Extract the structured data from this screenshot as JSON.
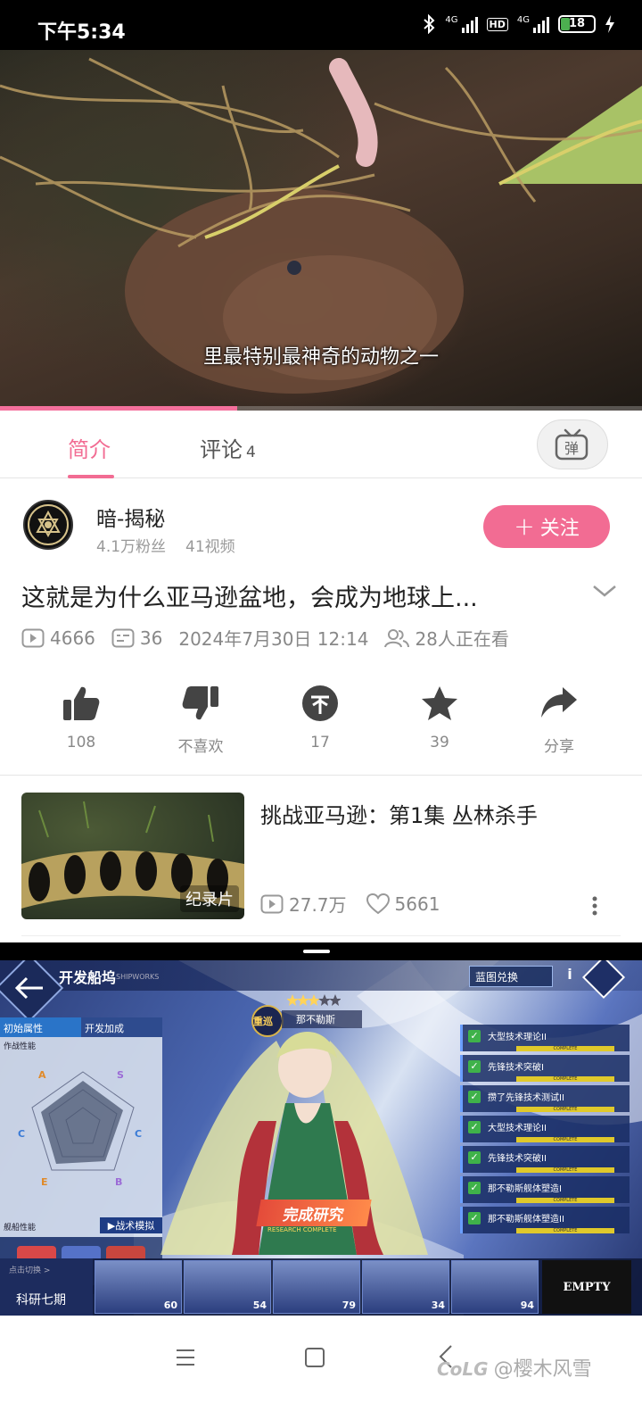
{
  "status_bar": {
    "time": "下午5:34",
    "sim1_label": "4G",
    "sim2_label": "4G",
    "hd_label": "HD",
    "battery": "18"
  },
  "video": {
    "subtitle": "里最特别最神奇的动物之一",
    "progress_percent": 37
  },
  "tabs": {
    "intro_label": "简介",
    "comments_label": "评论",
    "comments_count": "4"
  },
  "uploader": {
    "name": "暗-揭秘",
    "fans": "4.1万粉丝",
    "videos": "41视频",
    "follow_label": "关注"
  },
  "video_info": {
    "title": "这就是为什么亚马逊盆地，会成为地球上...",
    "plays": "4666",
    "danmaku": "36",
    "date": "2024年7月30日 12:14",
    "watching": "28人正在看"
  },
  "actions": [
    {
      "label": "108",
      "icon": "thumbs-up-icon"
    },
    {
      "label": "不喜欢",
      "icon": "thumbs-down-icon"
    },
    {
      "label": "17",
      "icon": "coin-icon"
    },
    {
      "label": "39",
      "icon": "star-icon"
    },
    {
      "label": "分享",
      "icon": "share-icon"
    }
  ],
  "related": {
    "title": "挑战亚马逊：第1集 丛林杀手",
    "tag": "纪录片",
    "plays": "27.7万",
    "likes": "5661"
  },
  "game": {
    "title": "开发船坞",
    "title_sub": "SHIPWORKS",
    "blueprint_button": "蓝图兑换",
    "tab_initial": "初始属性",
    "tab_dev": "开发加成",
    "section_perf": "作战性能",
    "ship_perf": "舰船性能",
    "sim_button": "▶战术模拟",
    "ship_rank": "重巡",
    "ship_name": "那不勒斯",
    "complete_label": "完成研究",
    "complete_sub": "RESEARCH COMPLETE",
    "tasks": [
      "大型技术理论II",
      "先锋技术突破I",
      "攒了先锋技术测试II",
      "大型技术理论II",
      "先锋技术突破II",
      "那不勒斯舰体塑造I",
      "那不勒斯舰体塑造II"
    ],
    "task_complete": "COMPLETE",
    "series_switch": "点击切换 >",
    "series_name": "科研七期",
    "roster_levels": [
      "60",
      "54",
      "79",
      "34",
      "94"
    ],
    "empty_label": "EMPTY",
    "accent_colors": {
      "red": "#e44b3a",
      "navy": "#1d2c5e"
    }
  },
  "nav": {
    "watermark_logo": "CoLG",
    "watermark_text": "@樱木风雪"
  },
  "colors": {
    "accent": "#f26c93"
  }
}
